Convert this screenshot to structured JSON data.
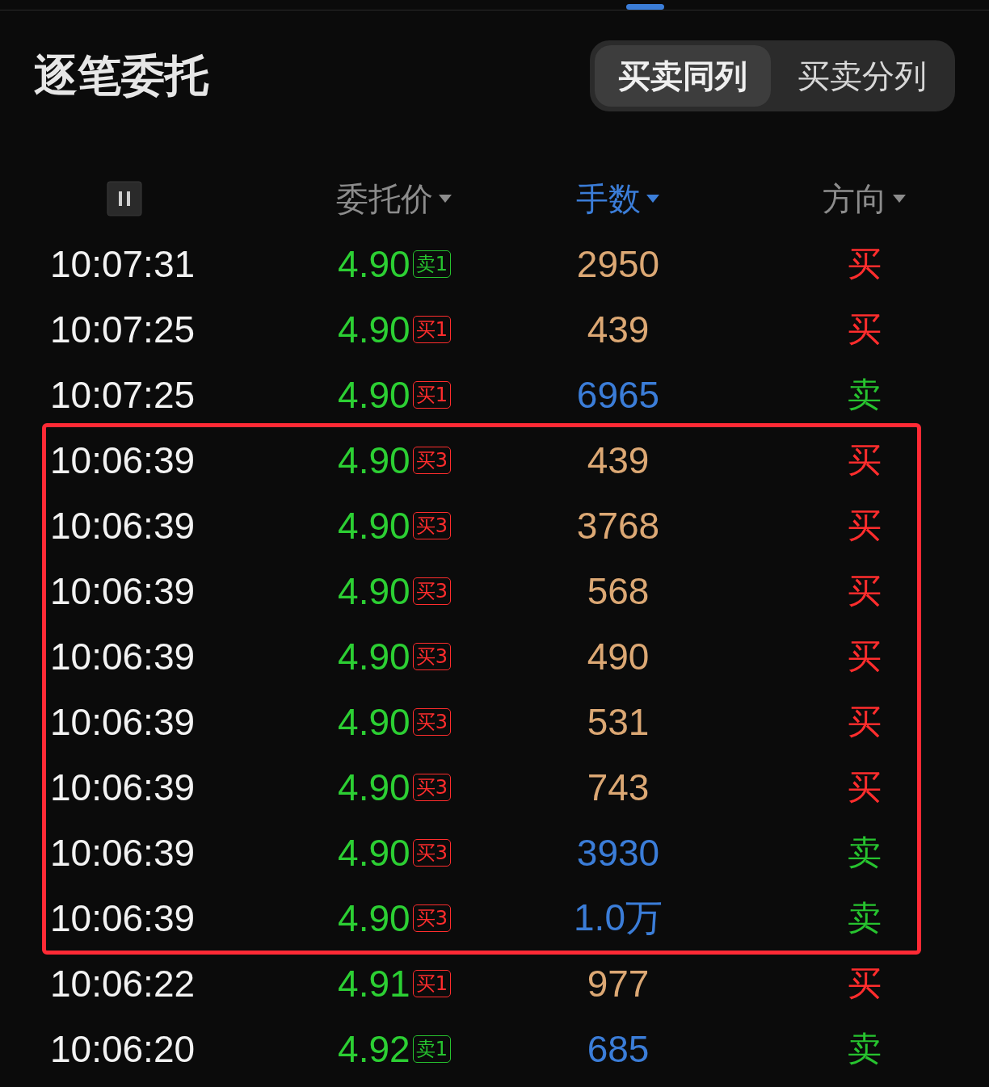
{
  "title": "逐笔委托",
  "view_toggle": [
    {
      "label": "买卖同列",
      "selected": true
    },
    {
      "label": "买卖分列",
      "selected": false
    }
  ],
  "columns": [
    {
      "label": "委托价",
      "active": false
    },
    {
      "label": "手数",
      "active": true
    },
    {
      "label": "方向",
      "active": false
    }
  ],
  "rows": [
    {
      "time": "10:07:31",
      "price": "4.90",
      "tag": {
        "label": "卖1",
        "color": "#27c32f"
      },
      "quantity": "2950",
      "direction": "买",
      "kind": "buy"
    },
    {
      "time": "10:07:25",
      "price": "4.90",
      "tag": {
        "label": "买1",
        "color": "#ff2d2d"
      },
      "quantity": "439",
      "direction": "买",
      "kind": "buy"
    },
    {
      "time": "10:07:25",
      "price": "4.90",
      "tag": {
        "label": "买1",
        "color": "#ff2d2d"
      },
      "quantity": "6965",
      "direction": "卖",
      "kind": "sell"
    }
  ],
  "highlight_box": {
    "rows": [
      {
        "time": "10:06:39",
        "price": "4.90",
        "tag": {
          "label": "买3",
          "color": "#ff2d2d"
        },
        "quantity": "439",
        "direction": "买",
        "kind": "buy"
      },
      {
        "time": "10:06:39",
        "price": "4.90",
        "tag": {
          "label": "买3",
          "color": "#ff2d2d"
        },
        "quantity": "3768",
        "direction": "买",
        "kind": "buy"
      },
      {
        "time": "10:06:39",
        "price": "4.90",
        "tag": {
          "label": "买3",
          "color": "#ff2d2d"
        },
        "quantity": "568",
        "direction": "买",
        "kind": "buy"
      },
      {
        "time": "10:06:39",
        "price": "4.90",
        "tag": {
          "label": "买3",
          "color": "#ff2d2d"
        },
        "quantity": "490",
        "direction": "买",
        "kind": "buy"
      },
      {
        "time": "10:06:39",
        "price": "4.90",
        "tag": {
          "label": "买3",
          "color": "#ff2d2d"
        },
        "quantity": "531",
        "direction": "买",
        "kind": "buy"
      },
      {
        "time": "10:06:39",
        "price": "4.90",
        "tag": {
          "label": "买3",
          "color": "#ff2d2d"
        },
        "quantity": "743",
        "direction": "买",
        "kind": "buy"
      },
      {
        "time": "10:06:39",
        "price": "4.90",
        "tag": {
          "label": "买3",
          "color": "#ff2d2d"
        },
        "quantity": "3930",
        "direction": "卖",
        "kind": "sell"
      },
      {
        "time": "10:06:39",
        "price": "4.90",
        "tag": {
          "label": "买3",
          "color": "#ff2d2d"
        },
        "quantity": "1.0万",
        "direction": "卖",
        "kind": "sell"
      }
    ]
  },
  "more_rows": [
    {
      "time": "10:06:22",
      "price": "4.91",
      "tag": {
        "label": "买1",
        "color": "#ff2d2d"
      },
      "quantity": "977",
      "direction": "买",
      "kind": "buy"
    },
    {
      "time": "10:06:20",
      "price": "4.92",
      "tag": {
        "label": "卖1",
        "color": "#27c32f"
      },
      "quantity": "685",
      "direction": "卖",
      "kind": "sell"
    }
  ]
}
